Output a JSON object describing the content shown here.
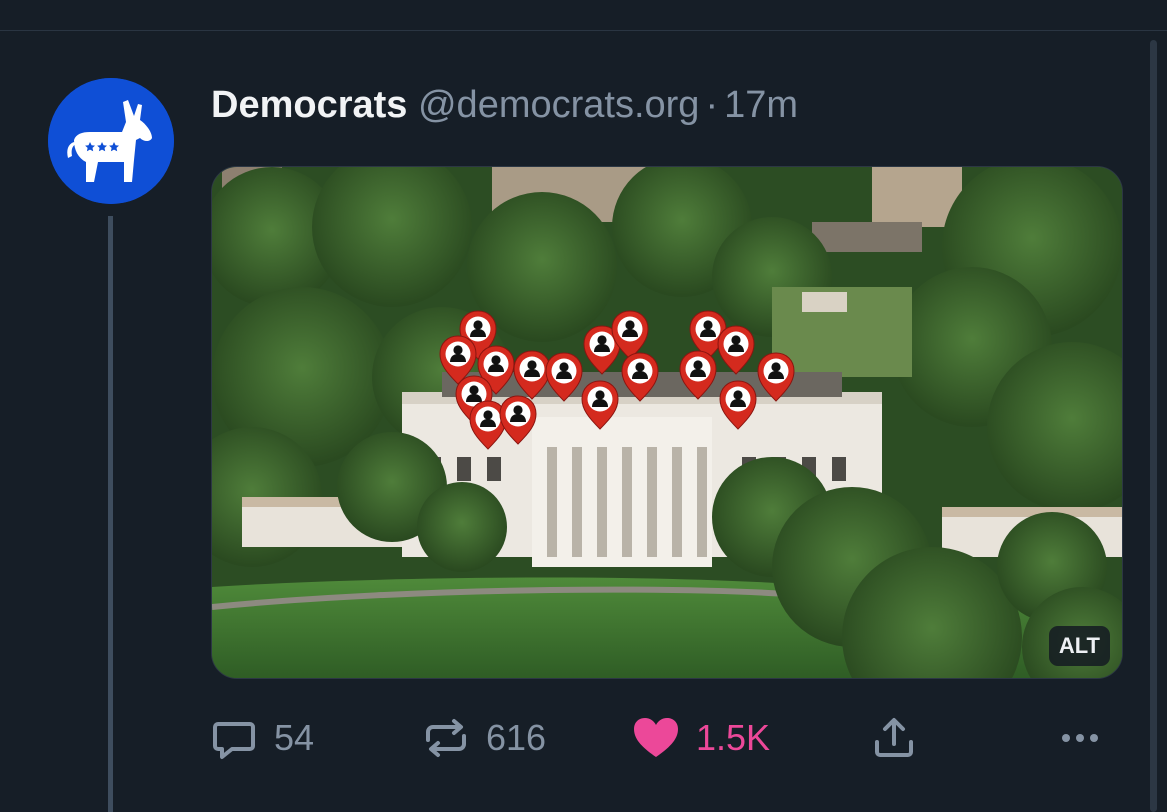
{
  "post": {
    "display_name": "Democrats",
    "handle": "@democrats.org",
    "separator": "·",
    "time": "17m",
    "media": {
      "alt_badge": "ALT"
    },
    "actions": {
      "reply_count": "54",
      "repost_count": "616",
      "like_count": "1.5K"
    }
  },
  "colors": {
    "background": "#161e27",
    "accent_like": "#ec4899",
    "avatar": "#0f4fd6",
    "muted": "#8593a4"
  },
  "icons": {
    "reply": "speech-bubble-icon",
    "repost": "repost-arrows-icon",
    "like": "heart-icon",
    "share": "share-upload-icon",
    "more": "ellipsis-icon"
  }
}
